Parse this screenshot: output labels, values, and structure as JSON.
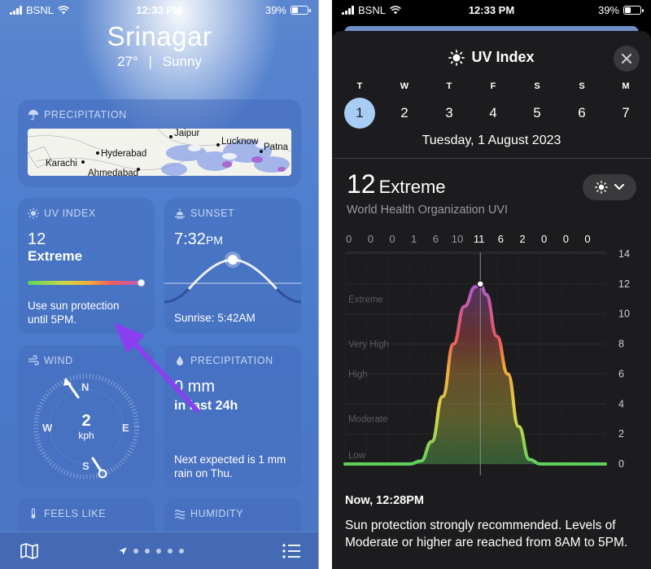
{
  "left": {
    "status": {
      "carrier": "BSNL",
      "time": "12:33 PM",
      "battery": "39%"
    },
    "city": "Srinagar",
    "temp": "27°",
    "sep": "|",
    "condition": "Sunny",
    "precip_card": {
      "title": "PRECIPITATION",
      "map_labels": [
        "Jaipur",
        "Lucknow",
        "Patna",
        "Hyderabad",
        "Karachi",
        "Ahmedabad"
      ]
    },
    "uv_card": {
      "title": "UV INDEX",
      "value": "12",
      "level": "Extreme",
      "level_fraction": 0.97,
      "advice_line1": "Use sun protection",
      "advice_line2": "until 5PM."
    },
    "sunset_card": {
      "title": "SUNSET",
      "time": "7:32",
      "ampm": "PM",
      "sunrise": "Sunrise: 5:42AM"
    },
    "wind_card": {
      "title": "WIND",
      "speed": "2",
      "unit": "kph",
      "n": "N",
      "e": "E",
      "s": "S",
      "w": "W"
    },
    "precip24_card": {
      "title": "PRECIPITATION",
      "amount": "0 mm",
      "period": "in last 24h",
      "next_line1": "Next expected is 1 mm",
      "next_line2": "rain on Thu."
    },
    "feels_card": {
      "title": "FEELS LIKE"
    },
    "humidity_card": {
      "title": "HUMIDITY"
    }
  },
  "right": {
    "status": {
      "carrier": "BSNL",
      "time": "12:33 PM",
      "battery": "39%"
    },
    "title": "UV Index",
    "days": [
      {
        "letter": "T",
        "num": "1",
        "selected": true
      },
      {
        "letter": "W",
        "num": "2"
      },
      {
        "letter": "T",
        "num": "3"
      },
      {
        "letter": "F",
        "num": "4"
      },
      {
        "letter": "S",
        "num": "5"
      },
      {
        "letter": "S",
        "num": "6"
      },
      {
        "letter": "M",
        "num": "7"
      }
    ],
    "date": "Tuesday, 1 August 2023",
    "uv_value": "12",
    "uv_level": "Extreme",
    "source": "World Health Organization UVI",
    "now_label": "Now, 12:28PM",
    "description": "Sun protection strongly recommended. Levels of Moderate or higher are reached from 8AM to 5PM."
  },
  "chart_data": {
    "type": "area",
    "hourly_labels": [
      "0",
      "0",
      "0",
      "1",
      "6",
      "10",
      "11",
      "6",
      "2",
      "0",
      "0",
      "0"
    ],
    "y_ticks": [
      0,
      2,
      4,
      6,
      8,
      10,
      12,
      14
    ],
    "ylim": [
      0,
      14
    ],
    "band_labels": [
      {
        "name": "Extreme",
        "y": 11
      },
      {
        "name": "Very High",
        "y": 8
      },
      {
        "name": "High",
        "y": 6
      },
      {
        "name": "Moderate",
        "y": 3
      },
      {
        "name": "Low",
        "y": 0.6
      }
    ],
    "x_hours": [
      0,
      1,
      2,
      3,
      4,
      5,
      6,
      7,
      8,
      9,
      10,
      11,
      12,
      12.47,
      13,
      14,
      15,
      16,
      17,
      18,
      19,
      20,
      21,
      22,
      23,
      24
    ],
    "y_values": [
      0,
      0,
      0,
      0,
      0,
      0,
      0,
      0.2,
      1.5,
      4.5,
      8,
      10.5,
      11.8,
      12,
      11.3,
      8.5,
      6,
      2.5,
      0.3,
      0,
      0,
      0,
      0,
      0,
      0,
      0
    ],
    "current_hour": 12.47,
    "colors": {
      "low": "#5ecf5e",
      "moderate": "#d2d64a",
      "high": "#f3a93c",
      "very_high": "#ea5a5a",
      "extreme": "#b45ad0"
    }
  }
}
